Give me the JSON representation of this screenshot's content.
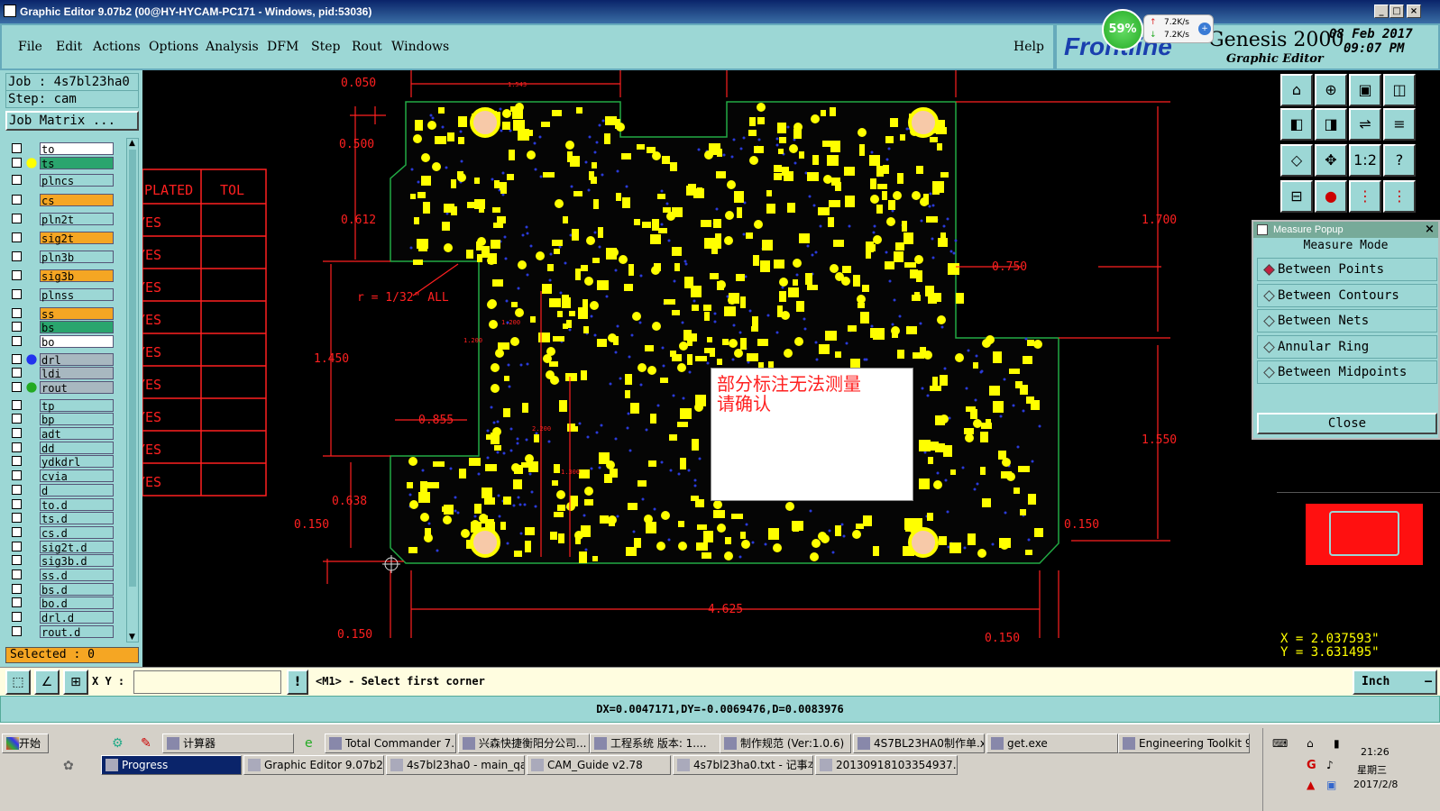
{
  "window": {
    "title": "Graphic Editor 9.07b2 (00@HY-HYCAM-PC171 - Windows, pid:53036)"
  },
  "menu": [
    "File",
    "Edit",
    "Actions",
    "Options",
    "Analysis",
    "DFM",
    "Step",
    "Rout",
    "Windows"
  ],
  "help": "Help",
  "brand": {
    "logo": "Frontline",
    "product": "Genesis 2000",
    "subtitle": "Graphic Editor",
    "date": "08 Feb 2017",
    "time": "09:07 PM"
  },
  "net": {
    "cpu": "59%",
    "up": "7.2K/s",
    "down": "7.2K/s"
  },
  "job": {
    "job_label": "Job : 4s7bl23ha0",
    "step_label": "Step: cam",
    "matrix_btn": "Job Matrix ..."
  },
  "layers": [
    {
      "name": "to",
      "color": "#ffffff"
    },
    {
      "name": "ts",
      "color": "#2aa56e"
    },
    {
      "name": "plncs",
      "color": "#9cd7d5"
    },
    {
      "name": "cs",
      "color": "#f5a623"
    },
    {
      "name": "pln2t",
      "color": "#9cd7d5"
    },
    {
      "name": "sig2t",
      "color": "#f5a623"
    },
    {
      "name": "pln3b",
      "color": "#9cd7d5"
    },
    {
      "name": "sig3b",
      "color": "#f5a623"
    },
    {
      "name": "plnss",
      "color": "#9cd7d5"
    },
    {
      "name": "ss",
      "color": "#f5a623"
    },
    {
      "name": "bs",
      "color": "#2aa56e"
    },
    {
      "name": "bo",
      "color": "#ffffff"
    },
    {
      "name": "drl",
      "color": "#a8b8c0"
    },
    {
      "name": "ldi",
      "color": "#a8b8c0"
    },
    {
      "name": "rout",
      "color": "#a8b8c0"
    },
    {
      "name": "tp",
      "color": "#9cd7d5"
    },
    {
      "name": "bp",
      "color": "#9cd7d5"
    },
    {
      "name": "adt",
      "color": "#9cd7d5"
    },
    {
      "name": "dd",
      "color": "#9cd7d5"
    },
    {
      "name": "ydkdrl",
      "color": "#9cd7d5"
    },
    {
      "name": "cvia",
      "color": "#9cd7d5"
    },
    {
      "name": "d",
      "color": "#9cd7d5"
    },
    {
      "name": "to.d",
      "color": "#9cd7d5"
    },
    {
      "name": "ts.d",
      "color": "#9cd7d5"
    },
    {
      "name": "cs.d",
      "color": "#9cd7d5"
    },
    {
      "name": "sig2t.d",
      "color": "#9cd7d5"
    },
    {
      "name": "sig3b.d",
      "color": "#9cd7d5"
    },
    {
      "name": "ss.d",
      "color": "#9cd7d5"
    },
    {
      "name": "bs.d",
      "color": "#9cd7d5"
    },
    {
      "name": "bo.d",
      "color": "#9cd7d5"
    },
    {
      "name": "drl.d",
      "color": "#9cd7d5"
    },
    {
      "name": "rout.d",
      "color": "#9cd7d5"
    }
  ],
  "selected": "Selected : 0",
  "drawing": {
    "table_headers": [
      "PLATED",
      "TOL"
    ],
    "table_rows": [
      "YES",
      "YES",
      "YES",
      "YES",
      "YES",
      "YES",
      "YES",
      "YES",
      "YES"
    ],
    "dims": {
      "d0050": "0.050",
      "d1543": "1.543",
      "d0500": "0.500",
      "d0612": "0.612",
      "radius_note": "r = 1/32\" ALL",
      "d1450": "1.450",
      "d1200a": "1.200",
      "d1200b": "1.200",
      "d0855": "0.855",
      "d0638": "0.638",
      "d0150l": "0.150",
      "d4625": "4.625",
      "d0150bl": "0.150",
      "d0150br": "0.150",
      "d0150r": "0.150",
      "d1700": "1.700",
      "d0750": "0.750",
      "d1550": "1.550",
      "d2200": "2.200",
      "d1300": "1.300"
    }
  },
  "note": {
    "line1": "部分标注无法测量",
    "line2": "请确认"
  },
  "measure": {
    "title": "Measure Popup",
    "mode": "Measure Mode",
    "options": [
      "Between Points",
      "Between Contours",
      "Between Nets",
      "Annular Ring",
      "Between Midpoints"
    ],
    "selected": 0,
    "close": "Close"
  },
  "coords": {
    "x": "X = 2.037593\"",
    "y": "Y = 3.631495\""
  },
  "cmd": {
    "xy_label": "X Y :",
    "xy_value": "",
    "prompt": "<M1> - Select first corner",
    "unit": "Inch"
  },
  "status": "DX=0.0047171,DY=-0.0069476,D=0.0083976",
  "taskbar": {
    "start": "开始",
    "row1": [
      "计算器",
      "Total Commander 7.0 ...",
      "兴森快捷衡阳分公司...",
      "工程系统 版本: 1....",
      "制作规范 (Ver:1.0.6)",
      "4S7BL23HA0制作单.x...",
      "get.exe",
      "Engineering Toolkit 9...."
    ],
    "row2": [
      "Progress",
      "Graphic Editor 9.07b2 ...",
      "4s7bl23ha0 - main_qa",
      "CAM_Guide v2.78",
      "4s7bl23ha0.txt - 记事本",
      "20130918103354937.rtf..."
    ],
    "clock": "21:26",
    "weekday": "星期三",
    "date": "2017/2/8"
  }
}
